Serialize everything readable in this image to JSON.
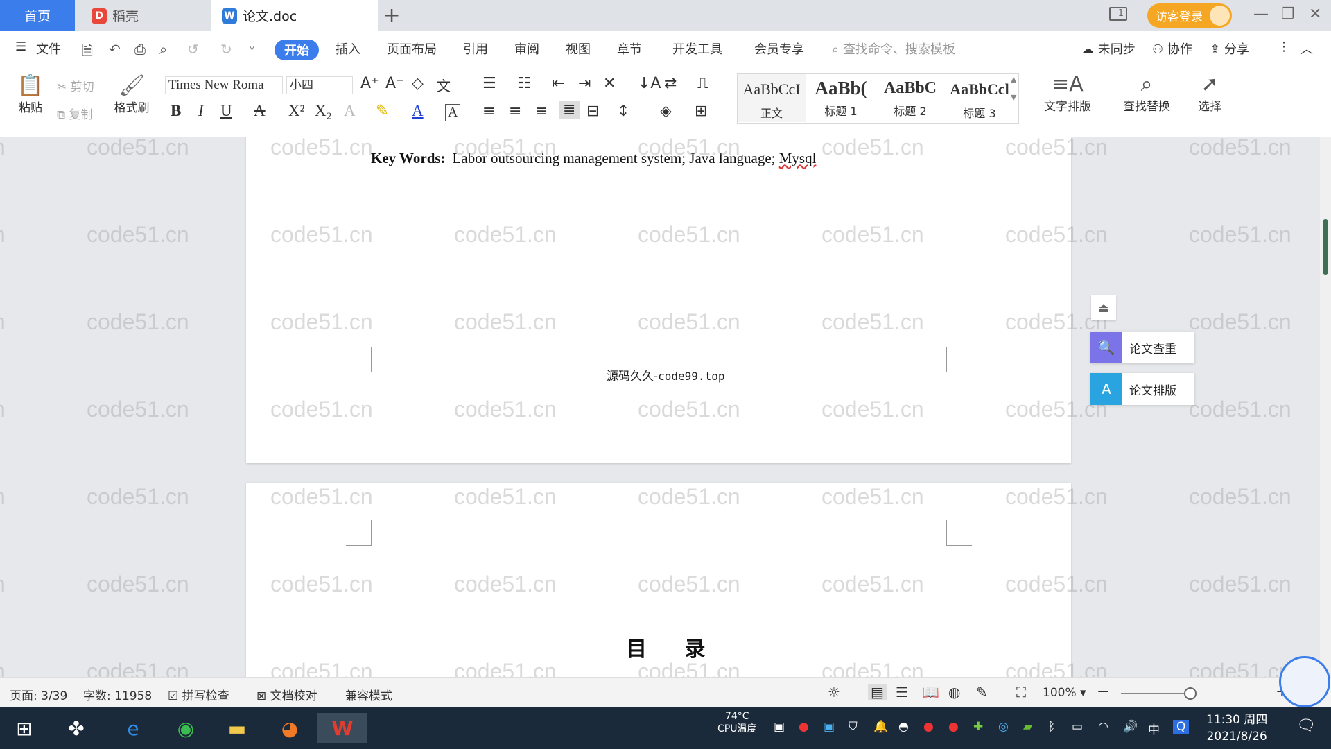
{
  "tabs": {
    "home": "首页",
    "daoke": "稻壳",
    "document": "论文.doc",
    "add": "+"
  },
  "titlebar": {
    "visitor_login": "访客登录",
    "page_indicator": "1"
  },
  "menu": {
    "file": "文件",
    "items": [
      "开始",
      "插入",
      "页面布局",
      "引用",
      "审阅",
      "视图",
      "章节",
      "开发工具",
      "会员专享"
    ],
    "search_placeholder": "查找命令、搜索模板",
    "sync": "未同步",
    "collaborate": "协作",
    "share": "分享"
  },
  "ribbon": {
    "paste": "粘贴",
    "cut": "剪切",
    "copy": "复制",
    "format_painter": "格式刷",
    "font_name": "Times New Roma",
    "font_size": "小四",
    "styles": [
      {
        "preview": "AaBbCcI",
        "name": "正文"
      },
      {
        "preview": "AaBb(",
        "name": "标题 1"
      },
      {
        "preview": "AaBbC",
        "name": "标题 2"
      },
      {
        "preview": "AaBbCcl",
        "name": "标题 3"
      }
    ],
    "text_layout": "文字排版",
    "find_replace": "查找替换",
    "select": "选择"
  },
  "document": {
    "keywords_label": "Key Words:",
    "keywords_text": "Labor outsourcing management system; Java language;",
    "keywords_last": "Mysql",
    "footer_cn": "源码久久-",
    "footer_url": "code99.top",
    "toc_title": "目 录",
    "watermark": "code51.cn"
  },
  "side_panel": {
    "check": "论文查重",
    "layout": "论文排版"
  },
  "status": {
    "page": "页面: 3/39",
    "word_count": "字数: 11958",
    "spell_check": "拼写检查",
    "doc_proof": "文档校对",
    "compat_mode": "兼容模式",
    "zoom": "100%"
  },
  "taskbar": {
    "cpu_temp": "74°C",
    "cpu_label": "CPU温度",
    "ime": "中",
    "time": "11:30 周四",
    "date": "2021/8/26"
  },
  "colors": {
    "accent": "#3b7dea",
    "visitor": "#f5a623",
    "taskbar": "#1b2a3a"
  }
}
